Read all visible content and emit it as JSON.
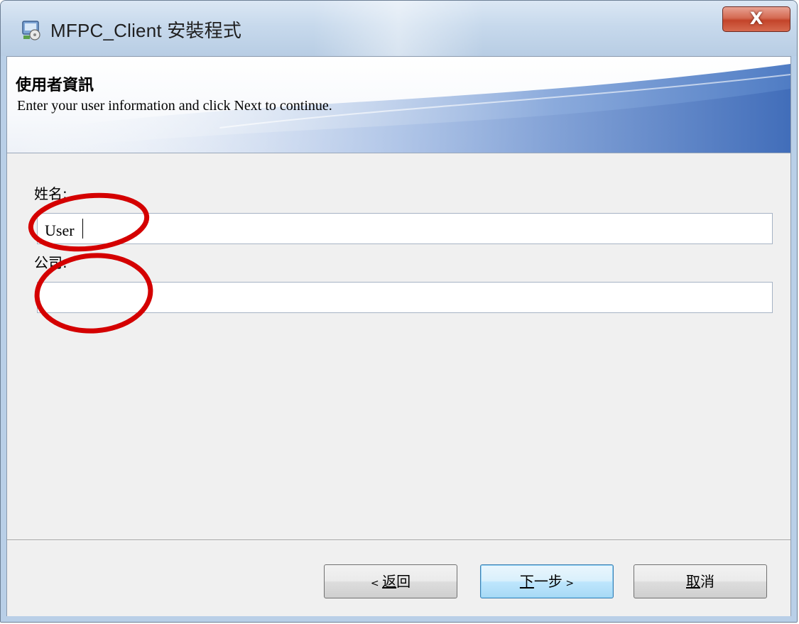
{
  "window": {
    "title": "MFPC_Client 安裝程式",
    "close_label": "X"
  },
  "banner": {
    "title": "使用者資訊",
    "subtitle": "Enter your user information and click Next to continue."
  },
  "form": {
    "name_label": "姓名:",
    "name_value": "User",
    "company_label": "公司:",
    "company_value": ""
  },
  "buttons": {
    "back": {
      "prefix": "< ",
      "accel": "返",
      "rest": "回"
    },
    "next": {
      "accel": "下",
      "rest": "一步",
      "suffix": " >"
    },
    "cancel": {
      "accel": "取",
      "rest": "消"
    }
  },
  "colors": {
    "annotation_circle": "#d40000",
    "title_bar": "#c7d9ec",
    "banner_accent": "#5b86c8",
    "close_button": "#c94a30"
  }
}
